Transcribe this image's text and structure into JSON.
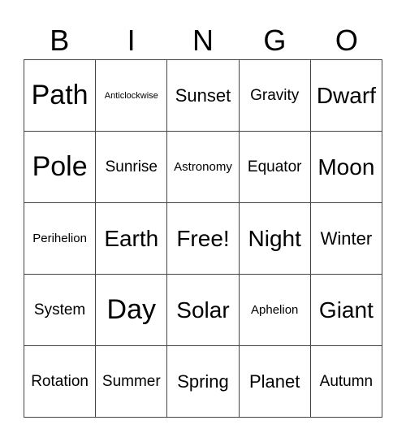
{
  "header": [
    "B",
    "I",
    "N",
    "G",
    "O"
  ],
  "rows": [
    [
      "Path",
      "Anticlockwise",
      "Sunset",
      "Gravity",
      "Dwarf"
    ],
    [
      "Pole",
      "Sunrise",
      "Astronomy",
      "Equator",
      "Moon"
    ],
    [
      "Perihelion",
      "Earth",
      "Free!",
      "Night",
      "Winter"
    ],
    [
      "System",
      "Day",
      "Solar",
      "Aphelion",
      "Giant"
    ],
    [
      "Rotation",
      "Summer",
      "Spring",
      "Planet",
      "Autumn"
    ]
  ]
}
